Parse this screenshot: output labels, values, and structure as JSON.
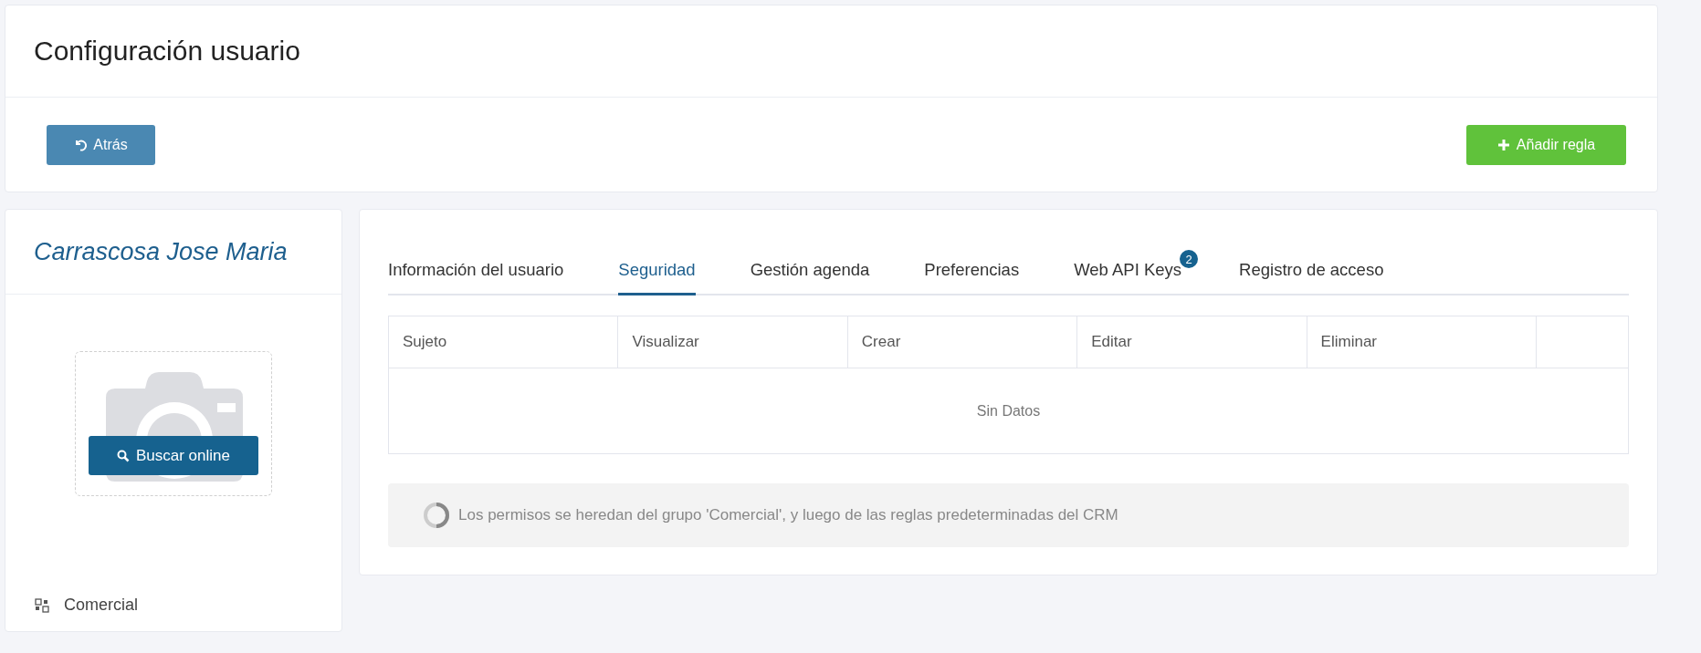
{
  "header": {
    "title": "Configuración usuario",
    "back_button": "Atrás",
    "add_button": "Añadir regla"
  },
  "profile": {
    "name": "Carrascosa Jose Maria",
    "photo_button": "Buscar online",
    "group": "Comercial"
  },
  "tabs": [
    {
      "label": "Información del usuario",
      "selected": false
    },
    {
      "label": "Seguridad",
      "selected": true
    },
    {
      "label": "Gestión agenda",
      "selected": false
    },
    {
      "label": "Preferencias",
      "selected": false
    },
    {
      "label": "Web API Keys",
      "selected": false,
      "badge": "2"
    },
    {
      "label": "Registro de acceso",
      "selected": false
    }
  ],
  "table": {
    "columns": [
      "Sujeto",
      "Visualizar",
      "Crear",
      "Editar",
      "Eliminar"
    ],
    "empty_text": "Sin Datos"
  },
  "note": "Los permisos se heredan del grupo 'Comercial', y luego de las reglas predeterminadas del CRM"
}
